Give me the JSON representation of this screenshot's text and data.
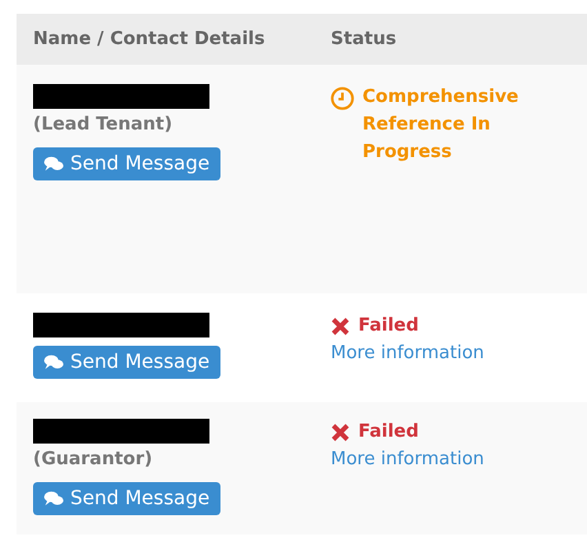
{
  "table": {
    "columns": [
      "Name / Contact Details",
      "Status"
    ],
    "rows": [
      {
        "name_redacted": true,
        "role": "(Lead Tenant)",
        "button": "Send Message",
        "status": {
          "kind": "in_progress",
          "text": "Comprehensive Reference In Progress"
        }
      },
      {
        "name_redacted": true,
        "button": "Send Message",
        "status": {
          "kind": "failed",
          "text": "Failed",
          "link": "More information"
        }
      },
      {
        "name_redacted": true,
        "role": "(Guarantor)",
        "button": "Send Message",
        "status": {
          "kind": "failed",
          "text": "Failed",
          "link": "More information"
        }
      }
    ]
  }
}
